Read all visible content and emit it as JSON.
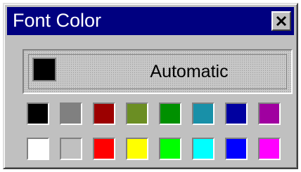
{
  "dialog": {
    "title": "Font Color",
    "close_icon": "close-icon",
    "automatic": {
      "label": "Automatic",
      "color": "#000000"
    }
  },
  "palette": {
    "rows": [
      [
        "#000000",
        "#808080",
        "#9c0000",
        "#6b8e23",
        "#009000",
        "#1890a8",
        "#0000a0",
        "#a000a0"
      ],
      [
        "#ffffff",
        "#c0c0c0",
        "#ff0000",
        "#ffff00",
        "#00ff00",
        "#00ffff",
        "#0000ff",
        "#ff00ff"
      ]
    ]
  }
}
